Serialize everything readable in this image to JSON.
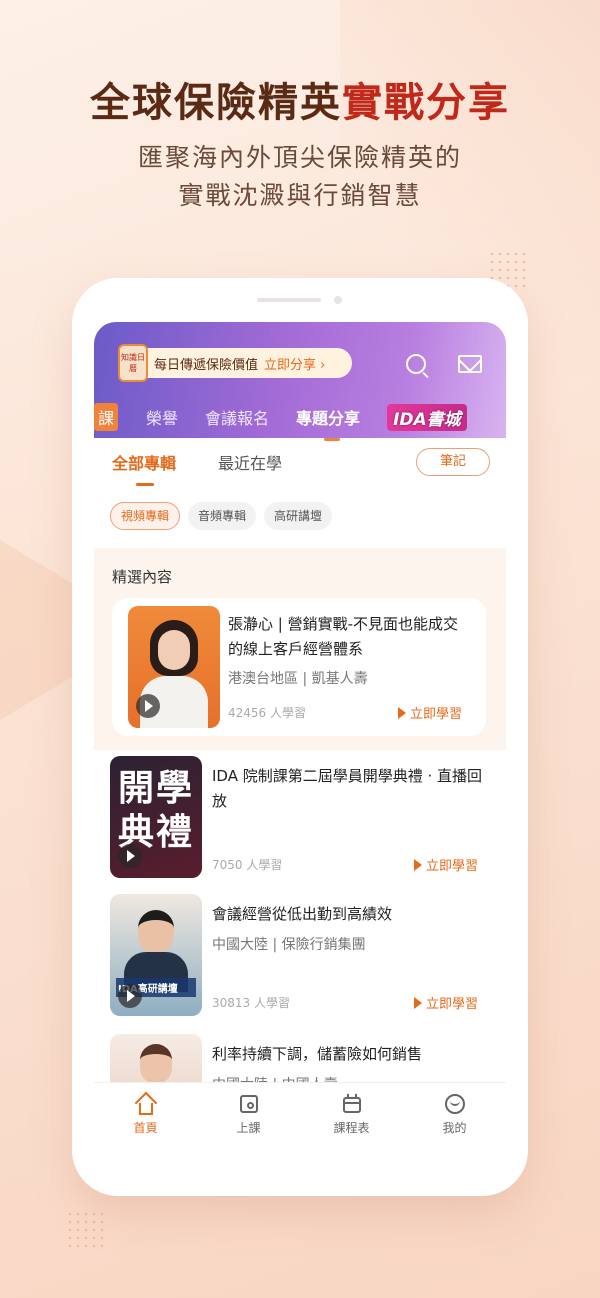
{
  "headline": {
    "dark": "全球保險精英",
    "red": "實戰分享"
  },
  "subline": [
    "匯聚海內外頂尖保險精英的",
    "實戰沈澱與行銷智慧"
  ],
  "banner": {
    "tag": "知識日曆",
    "text": "每日傳遞保險價值",
    "link": "立即分享 ›"
  },
  "navtabs": [
    "課",
    "榮譽",
    "會議報名",
    "專題分享",
    "IDA書城"
  ],
  "subtabs": [
    "全部專輯",
    "最近在學"
  ],
  "notes_label": "筆記",
  "chips": [
    "視頻專輯",
    "音頻專輯",
    "高研講壇"
  ],
  "featured_label": "精選內容",
  "cards": [
    {
      "title": "張瀞心 | 營銷實戰-不見面也能成交的線上客戶經營體系",
      "meta": "港澳台地區 | 凱基人壽",
      "count": "42456 人學習",
      "action": "立即學習"
    },
    {
      "title": "IDA 院制課第二屆學員開學典禮 · 直播回放",
      "meta": "",
      "count": "7050 人學習",
      "action": "立即學習",
      "thumb_text": "開學典禮"
    },
    {
      "title": "會議經營從低出勤到高績效",
      "meta": "中國大陸 | 保險行銷集團",
      "count": "30813 人學習",
      "action": "立即學習",
      "thumb_text": "IDA高研講壇"
    },
    {
      "title": "利率持續下調，儲蓄險如何銷售",
      "meta": "中國大陸 | 中國人壽",
      "count": "",
      "action": ""
    }
  ],
  "bottomnav": [
    "首頁",
    "上課",
    "課程表",
    "我的"
  ],
  "colors": {
    "accent": "#e46a1c",
    "headline_red": "#c0281a",
    "headline_dark": "#5a2a14"
  }
}
